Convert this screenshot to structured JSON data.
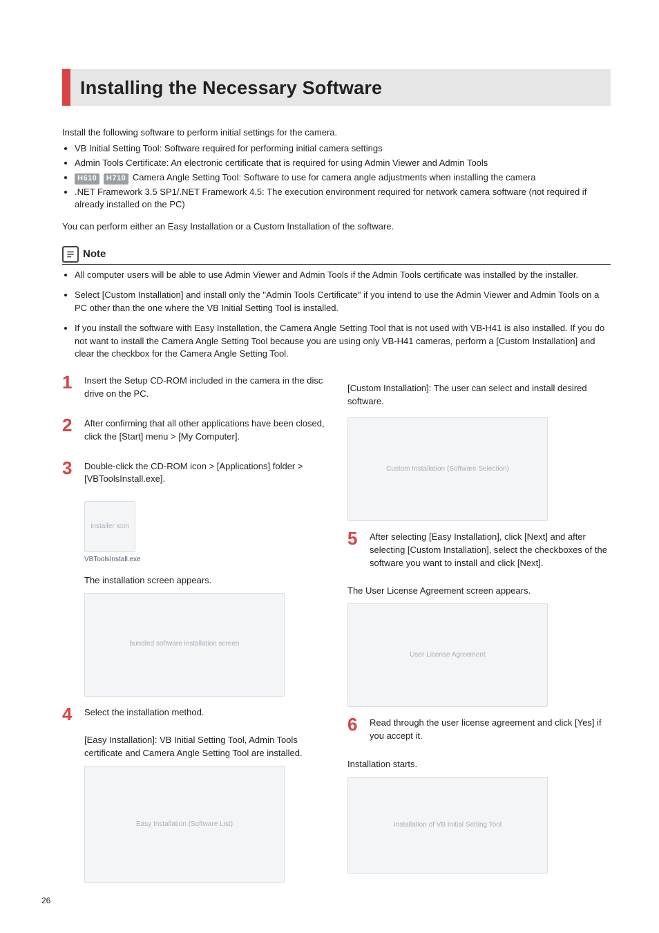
{
  "page": {
    "number": "26",
    "title": "Installing the Necessary Software"
  },
  "intro": {
    "lead": "Install the following software to perform initial settings for the camera.",
    "bullets": [
      "VB Initial Setting Tool: Software required for performing initial camera settings",
      "Admin Tools Certificate: An electronic certificate that is required for using Admin Viewer and Admin Tools",
      {
        "models": [
          "H610",
          "H710"
        ],
        "text": "Camera Angle Setting Tool: Software to use for camera angle adjustments when installing the camera"
      },
      ".NET Framework 3.5 SP1/.NET Framework 4.5: The execution environment required for network camera software (not required if already installed on the PC)"
    ],
    "outro": "You can perform either an Easy Installation or a Custom Installation of the software."
  },
  "note": {
    "heading": "Note",
    "items": [
      "All computer users will be able to use Admin Viewer and Admin Tools if the Admin Tools certificate was installed by the installer.",
      "Select [Custom Installation] and install only the \"Admin Tools Certificate\" if you intend to use the Admin Viewer and Admin Tools on a PC other than the one where the VB Initial Setting Tool is installed.",
      "If you install the software with Easy Installation, the Camera Angle Setting Tool that is not used with VB-H41 is also installed. If you do not want to install the Camera Angle Setting Tool because you are using only VB-H41 cameras, perform a [Custom Installation] and clear the checkbox for the Camera Angle Setting Tool."
    ]
  },
  "steps": {
    "s1": "Insert the Setup CD-ROM included in the camera in the disc drive on the PC.",
    "s2": "After confirming that all other applications have been closed, click the [Start] menu > [My Computer].",
    "s3": "Double-click the CD-ROM icon > [Applications] folder > [VBToolsInstall.exe].",
    "s3_iconlabel": "VBToolsInstall.exe",
    "s3_after": "The installation screen appears.",
    "s4": "Select the installation method.",
    "s4_sub": "[Easy Installation]: VB Initial Setting Tool, Admin Tools certificate and Camera Angle Setting Tool are installed.",
    "s4_sub_right": "[Custom Installation]: The user can select and install desired software.",
    "s5": "After selecting [Easy Installation], click [Next] and after selecting [Custom Installation], select the checkboxes of the software you want to install and click [Next].",
    "s5_after": "The User License Agreement screen appears.",
    "s6": "Read through the user license agreement and click [Yes] if you accept it.",
    "s6_after": "Installation starts."
  },
  "placeholders": {
    "installer_icon": "installer icon",
    "install_screen": "bundled software installation screen",
    "easy_list": "Easy Installation (Software List)",
    "custom_list": "Custom Installation (Software Selection)",
    "license": "User License Agreement",
    "progress": "Installation of VB Initial Setting Tool"
  }
}
